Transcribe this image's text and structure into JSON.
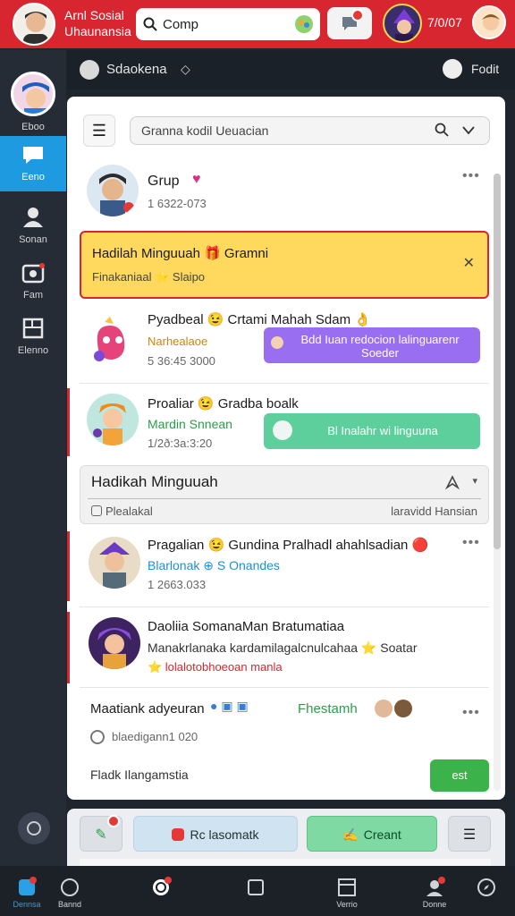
{
  "topbar": {
    "brand_line1": "Arnl Sosial",
    "brand_line2": "Uhaunansia",
    "search_value": "Comp",
    "count": "7/0/07"
  },
  "subbar": {
    "title": "Sdaokena",
    "right_label": "Fodit"
  },
  "rail": {
    "avatar_label": "Eboo",
    "items": [
      {
        "label": "Eeno",
        "icon": "chat-bubble-icon",
        "active": true
      },
      {
        "label": "Sonan",
        "icon": "people-icon",
        "active": false
      },
      {
        "label": "Fam",
        "icon": "camera-icon",
        "active": false
      },
      {
        "label": "Elenno",
        "icon": "list-icon",
        "active": false
      }
    ]
  },
  "panel": {
    "search_value": "Granna kodil Ueuacian",
    "rows": {
      "group": {
        "title": "Grup",
        "date": "1 6322-073"
      },
      "banner": {
        "title": "Hadilah Minguuah 🎁 Gramni",
        "subtitle": "Finakaniaal ⭐ Slaipo"
      },
      "row2": {
        "title": "Pyadbeal 😉 Crtami Mahah Sdam 👌",
        "sub": "Narhealaoe",
        "date": "5 36:45 3000",
        "pill": "Bdd Iuan redocion lalinguarenr Soeder"
      },
      "row3": {
        "title": "Proaliar 😉 Gradba boalk",
        "sub": "Mardin Snnean",
        "date": "1/2ð:3a:3:20",
        "pill": "Bl Inalahr wi linguuna"
      },
      "section": {
        "title": "Hadikah Minguuah",
        "left": "Plealakal",
        "right": "laravidd Hansian"
      },
      "row4": {
        "title": "Pragalian 😉 Gundina Pralhadl ahahlsadian 🔴",
        "sub": "Blarlonak ⊕ S Onandes",
        "date": "1 2663.033"
      },
      "row5": {
        "title": "Daoliia SomanaMan Bratumatiaa",
        "sub": "Manakrlanaka kardamilagalcnulcahaa ⭐ Soatar",
        "sub2": "⭐ lolalotobhoeoan manla"
      },
      "row6": {
        "title": "Maatiank adyeuran",
        "tag": "Fhestamh",
        "date": "blaedigann1 020"
      }
    },
    "footer_text": "Fladk Ilangamstia",
    "send_label": "est"
  },
  "actionbar": {
    "react_label": "Rc lasomatk",
    "create_label": "Creant"
  },
  "bottomnav": {
    "items": [
      {
        "label": "Dennsa",
        "icon": "chat-icon",
        "active": true
      },
      {
        "label": "Bannd",
        "icon": "globe-icon",
        "active": false
      },
      {
        "label": "",
        "icon": "bell-icon",
        "active": false
      },
      {
        "label": "",
        "icon": "square-icon",
        "active": false
      },
      {
        "label": "Verrio",
        "icon": "window-icon",
        "active": false
      },
      {
        "label": "Donne",
        "icon": "profile-icon",
        "active": false
      },
      {
        "label": "",
        "icon": "compass-icon",
        "active": false
      }
    ]
  },
  "colors": {
    "brand_red": "#d7262f",
    "accent_blue": "#1e9be0",
    "banner_yellow": "#ffd95e",
    "pill_purple": "#9a6ef0",
    "pill_teal": "#5ccf9c",
    "send_green": "#3bb34a"
  }
}
